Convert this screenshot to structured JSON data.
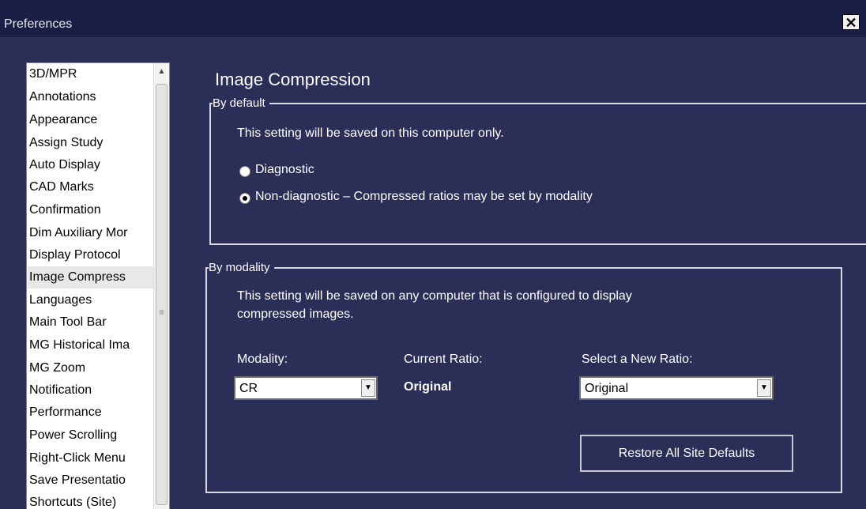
{
  "window": {
    "title": "Preferences",
    "close_glyph": "✕"
  },
  "sidebar": {
    "items": [
      {
        "label": "3D/MPR"
      },
      {
        "label": "Annotations"
      },
      {
        "label": "Appearance"
      },
      {
        "label": "Assign Study"
      },
      {
        "label": "Auto Display"
      },
      {
        "label": "CAD Marks"
      },
      {
        "label": "Confirmation"
      },
      {
        "label": "Dim Auxiliary Mor"
      },
      {
        "label": "Display Protocol"
      },
      {
        "label": "Image Compress"
      },
      {
        "label": "Languages"
      },
      {
        "label": "Main Tool Bar"
      },
      {
        "label": "MG Historical Ima"
      },
      {
        "label": "MG Zoom"
      },
      {
        "label": "Notification"
      },
      {
        "label": "Performance"
      },
      {
        "label": "Power Scrolling"
      },
      {
        "label": "Right-Click Menu"
      },
      {
        "label": "Save Presentatio"
      },
      {
        "label": "Shortcuts (Site)"
      }
    ],
    "selected": "Image Compress"
  },
  "main": {
    "title": "Image Compression",
    "by_default": {
      "legend": "By default",
      "note": "This setting will be saved on this computer only.",
      "options": [
        {
          "label": "Diagnostic",
          "checked": false
        },
        {
          "label": "Non-diagnostic – Compressed ratios may be set by modality",
          "checked": true
        }
      ]
    },
    "by_modality": {
      "legend": "By modality",
      "note_line1": "This setting will be saved on any computer that is configured to display",
      "note_line2": "compressed images.",
      "modality_label": "Modality:",
      "modality_value": "CR",
      "current_ratio_label": "Current Ratio:",
      "current_ratio_value": "Original",
      "new_ratio_label": "Select a New Ratio:",
      "new_ratio_value": "Original",
      "restore_button": "Restore All Site Defaults"
    }
  },
  "colors": {
    "background": "#2b2f57",
    "titlebar": "#1b1f45"
  }
}
